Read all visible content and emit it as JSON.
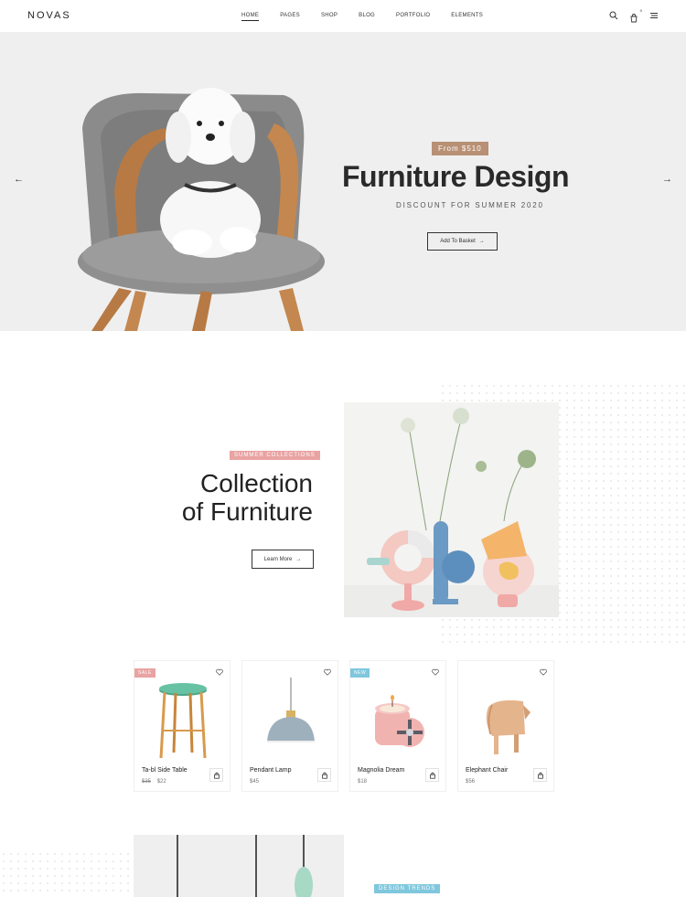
{
  "header": {
    "logo": "NOVAS",
    "nav": [
      "HOME",
      "PAGES",
      "SHOP",
      "BLOG",
      "PORTFOLIO",
      "ELEMENTS"
    ],
    "active_nav": "HOME",
    "cart_count": "0",
    "icons": [
      "search-icon",
      "cart-icon",
      "menu-icon"
    ]
  },
  "hero": {
    "price_badge": "From $510",
    "title": "Furniture Design",
    "subtitle": "DISCOUNT FOR SUMMER 2020",
    "button_label": "Add To Basket",
    "arrow_left": "←",
    "arrow_right": "→"
  },
  "collection": {
    "tag": "SUMMER COLLECTIONS",
    "title_line1": "Collection",
    "title_line2": "of Furniture",
    "button_label": "Learn More"
  },
  "products": [
    {
      "name": "Ta-bl Side Table",
      "old_price": "$35",
      "price": "$22",
      "badge": "SALE"
    },
    {
      "name": "Pendant Lamp",
      "old_price": "",
      "price": "$45",
      "badge": ""
    },
    {
      "name": "Magnolia Dream",
      "old_price": "",
      "price": "$18",
      "badge": "NEW"
    },
    {
      "name": "Elephant Chair",
      "old_price": "",
      "price": "$56",
      "badge": ""
    }
  ],
  "design_trends": {
    "tag": "DESIGN TRENDS"
  },
  "colors": {
    "accent_brown": "#b89075",
    "tag_pink": "#e9a3a3",
    "tag_blue": "#7fc7dc",
    "hero_bg": "#efefef"
  }
}
